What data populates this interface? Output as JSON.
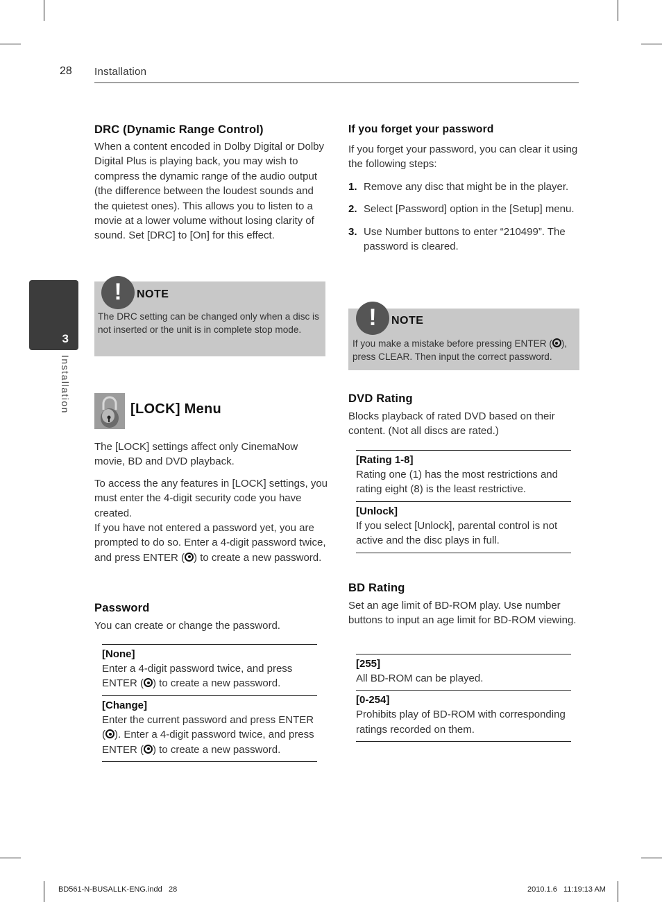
{
  "header": {
    "page_number": "28",
    "section": "Installation"
  },
  "side_tab": {
    "chapter_number": "3",
    "chapter_label": "Installation"
  },
  "drc": {
    "heading": "DRC (Dynamic Range Control)",
    "body": "When a content encoded in Dolby Digital or Dolby Digital Plus is playing back, you may wish to compress the dynamic range of the audio output (the difference between the loudest sounds and the quietest ones). This allows you to listen to a movie at a lower volume without losing clarity of sound. Set [DRC] to [On] for this effect.",
    "note": {
      "icon": "exclamation-icon",
      "title": "NOTE",
      "text": "The DRC setting can be changed only when a disc is not inserted or the unit is in complete stop mode."
    }
  },
  "lock_menu": {
    "icon": "padlock-icon",
    "title": "[LOCK] Menu",
    "intro": "The [LOCK] settings affect only CinemaNow movie, BD and DVD playback.",
    "access_text_1": "To access the any features in [LOCK] settings, you must enter the 4-digit security code you have created.",
    "access_text_2a": "If you have not entered a password yet, you are prompted to do so. Enter a 4-digit password twice, and press ENTER (",
    "access_text_2b": ") to create a new password."
  },
  "password": {
    "heading": "Password",
    "intro": "You can create or change the password.",
    "options": [
      {
        "title": "[None]",
        "desc_a": "Enter a 4-digit password twice, and press ENTER (",
        "desc_b": ") to create a new password."
      },
      {
        "title": "[Change]",
        "desc_a": "Enter the current password and press ENTER (",
        "desc_b": "). Enter a 4-digit password twice, and press ENTER (",
        "desc_c": ") to create a new password."
      }
    ]
  },
  "forget": {
    "heading": "If you forget your password",
    "intro": "If you forget your password, you can clear it using the following steps:",
    "steps": [
      {
        "num": "1.",
        "text": "Remove any disc that might be in the player."
      },
      {
        "num": "2.",
        "text": "Select [Password] option in the [Setup] menu."
      },
      {
        "num": "3.",
        "text": "Use Number buttons to enter “210499”. The password is cleared."
      }
    ],
    "note": {
      "icon": "exclamation-icon",
      "title": "NOTE",
      "text_a": "If you make a mistake before pressing ENTER (",
      "text_b": "), press CLEAR. Then input the correct password."
    }
  },
  "dvd_rating": {
    "heading": "DVD Rating",
    "intro": "Blocks playback of rated DVD based on their content. (Not all discs are rated.)",
    "options": [
      {
        "title": "[Rating 1-8]",
        "desc": "Rating one (1) has the most restrictions and rating eight (8) is the least restrictive."
      },
      {
        "title": "[Unlock]",
        "desc": "If you select [Unlock], parental control is not active and the disc plays in full."
      }
    ]
  },
  "bd_rating": {
    "heading": "BD Rating",
    "intro": "Set an age limit of BD-ROM play. Use number buttons to input an age limit for BD-ROM viewing.",
    "options": [
      {
        "title": "[255]",
        "desc": "All BD-ROM can be played."
      },
      {
        "title": "[0-254]",
        "desc": "Prohibits play of BD-ROM with corresponding ratings recorded on them."
      }
    ]
  },
  "footer": {
    "file": "BD561-N-BUSALLK-ENG.indd   28",
    "timestamp": "2010.1.6   11:19:13 AM"
  }
}
